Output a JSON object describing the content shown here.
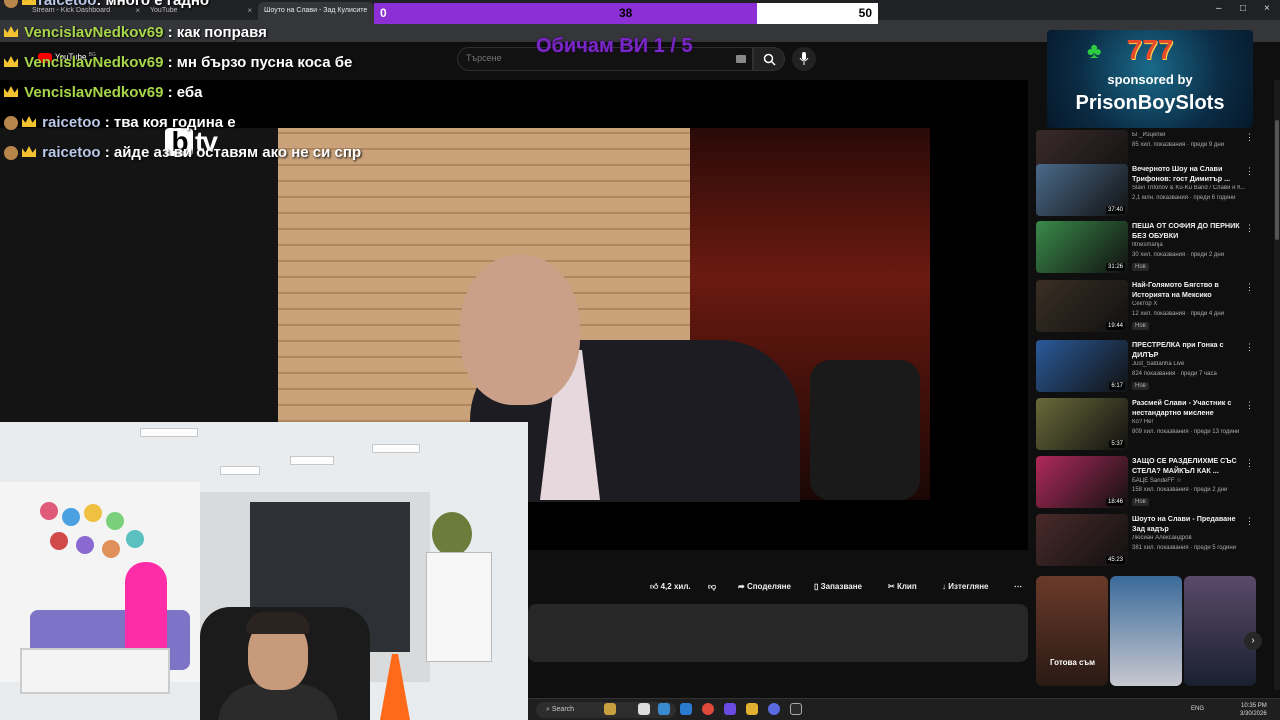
{
  "browser": {
    "tabs": [
      {
        "label": "Stream - Kick Dashboard"
      },
      {
        "label": "YouTube"
      },
      {
        "label": "Шоуто на Слави - Зад Кулисите"
      }
    ]
  },
  "youtube": {
    "logo_text": "YouTube",
    "logo_suffix": "BG",
    "search_placeholder": "Търсене"
  },
  "poll": {
    "left_value": "0",
    "mid_value": "38",
    "right_value": "50",
    "fill_fraction": 0.76,
    "title": "Обичам ВИ 1 / 5",
    "accent_color": "#8d2fd6"
  },
  "chat": [
    {
      "user": "raicetoo",
      "message": ": много е гадно",
      "color": "#b9c8e8"
    },
    {
      "user": "VencislavNedkov69",
      "message": ": как поправя",
      "color": "#a7d64a"
    },
    {
      "user": "VencislavNedkov69",
      "message": ": мн бързо пусна коса бе",
      "color": "#a7d64a"
    },
    {
      "user": "VencislavNedkov69",
      "message": ": еба",
      "color": "#a7d64a"
    },
    {
      "user": "raicetoo",
      "message": ": тва коя година е",
      "color": "#b9c8e8"
    },
    {
      "user": "raicetoo",
      "message": ": айде аз ви оставям ако не си спр",
      "color": "#b9c8e8"
    }
  ],
  "video": {
    "channel_logo": "tv"
  },
  "sponsor": {
    "number": "777",
    "by_text": "sponsored by",
    "name": "PrisonBoySlots"
  },
  "actions": {
    "like": "4,2 хил.",
    "share": "Споделяне",
    "save": "Запазване",
    "clip": "Клип",
    "download": "Изтегляне"
  },
  "recommendations": [
    {
      "title": "",
      "channel": "БГ_Изцепки",
      "meta": "85 хил. показвания · преди 9 дни",
      "duration": "18:41",
      "badge": "",
      "thumb_color": "#3a2a2a"
    },
    {
      "title": "Вечерното Шоу на Слави Трифонов: гост Димитър ...",
      "channel": "Slavi Trifonov & Ku-Ku Band / Слави и К...",
      "meta": "2,1 млн. показвания · преди 6 години",
      "duration": "37:40",
      "badge": "",
      "thumb_color": "#4a6a8a"
    },
    {
      "title": "ПЕША ОТ СОФИЯ ДО ПЕРНИК БЕЗ ОБУВКИ",
      "channel": "fitnesmanja",
      "meta": "30 хил. показвания · преди 2 дни",
      "duration": "31:26",
      "badge": "Нов",
      "thumb_color": "#3a8a4a"
    },
    {
      "title": "Най-Голямото Бягство в Историята на Мексико",
      "channel": "Сектор X",
      "meta": "12 хил. показвания · преди 4 дни",
      "duration": "19:44",
      "badge": "Нов",
      "thumb_color": "#3a2f25"
    },
    {
      "title": "ПРЕСТРЕЛКА при Гонка с ДИЛЪР",
      "channel": "Just_Saldanha Live",
      "meta": "824 показвания · преди 7 часа",
      "duration": "6:17",
      "badge": "Нов",
      "thumb_color": "#2a5a9a"
    },
    {
      "title": "Разсмей Слави - Участник с нестандартно мислене",
      "channel": "Ко? Не!",
      "meta": "809 хил. показвания · преди 13 години",
      "duration": "5:37",
      "badge": "",
      "thumb_color": "#6a6a3a"
    },
    {
      "title": "ЗАЩО СЕ РАЗДЕЛИХМЕ СЪС СТЕЛА? МАЙКЪЛ КАК ...",
      "channel": "БАЦЕ SandeFF ☆",
      "meta": "158 хил. показвания · преди 2 дни",
      "duration": "18:46",
      "badge": "Нов",
      "thumb_color": "#b02a5a"
    },
    {
      "title": "Шоуто на Слави - Предаване Зад кадър",
      "channel": "Люсиан Александров",
      "meta": "381 хил. показвания · преди 5 години",
      "duration": "45:23",
      "badge": "",
      "thumb_color": "#4a2a2a"
    }
  ],
  "shorts": {
    "caption": "Готова съм"
  },
  "taskbar": {
    "search": "Search",
    "lang": "ENG",
    "time": "10:35 PM",
    "date": "3/30/2026"
  }
}
